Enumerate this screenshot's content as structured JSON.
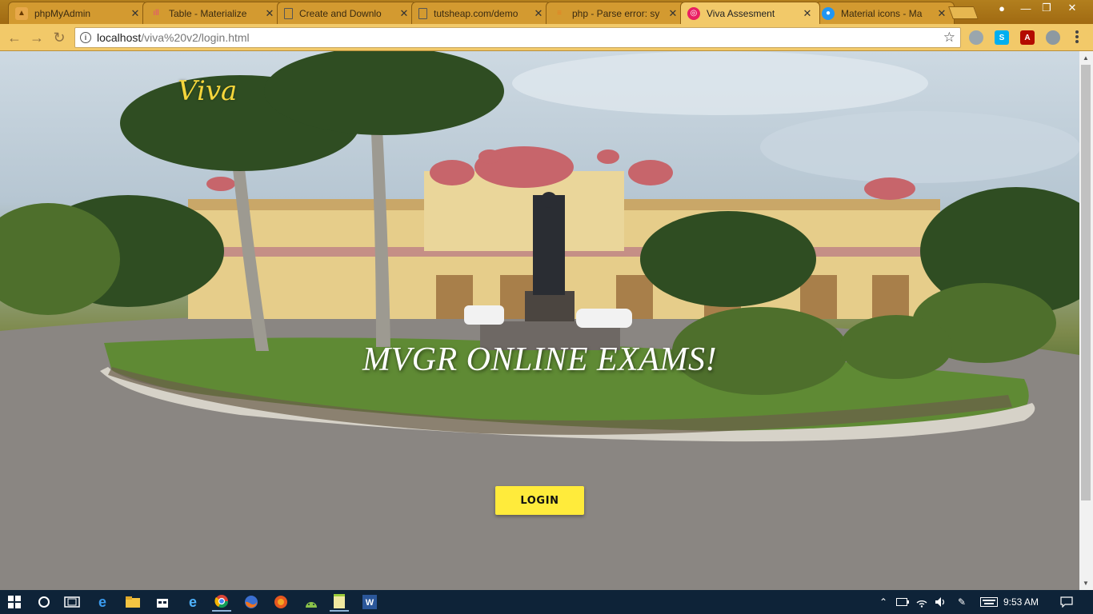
{
  "browser": {
    "tabs": [
      {
        "title": "phpMyAdmin",
        "icon": "phpmyadmin-icon",
        "active": false
      },
      {
        "title": "Table - Materialize",
        "icon": "materialize-icon",
        "active": false
      },
      {
        "title": "Create and Downlo",
        "icon": "document-icon",
        "active": false
      },
      {
        "title": "tutsheap.com/demo",
        "icon": "document-icon",
        "active": false
      },
      {
        "title": "php - Parse error: sy",
        "icon": "stackoverflow-icon",
        "active": false
      },
      {
        "title": "Viva Assesment",
        "icon": "viva-icon",
        "active": true
      },
      {
        "title": "Material icons - Ma",
        "icon": "material-icon",
        "active": false
      }
    ],
    "url_host": "localhost",
    "url_path": "/viva%20v2/login.html"
  },
  "page": {
    "brand": "Viva",
    "headline": "MVGR ONLINE EXAMS!",
    "login_label": "LOGIN"
  },
  "taskbar": {
    "clock": "9:53 AM"
  },
  "colors": {
    "brand": "#f5d63b",
    "login_button": "#ffeb3b",
    "tab_bar": "#b27f1e",
    "toolbar": "#f2c969"
  }
}
